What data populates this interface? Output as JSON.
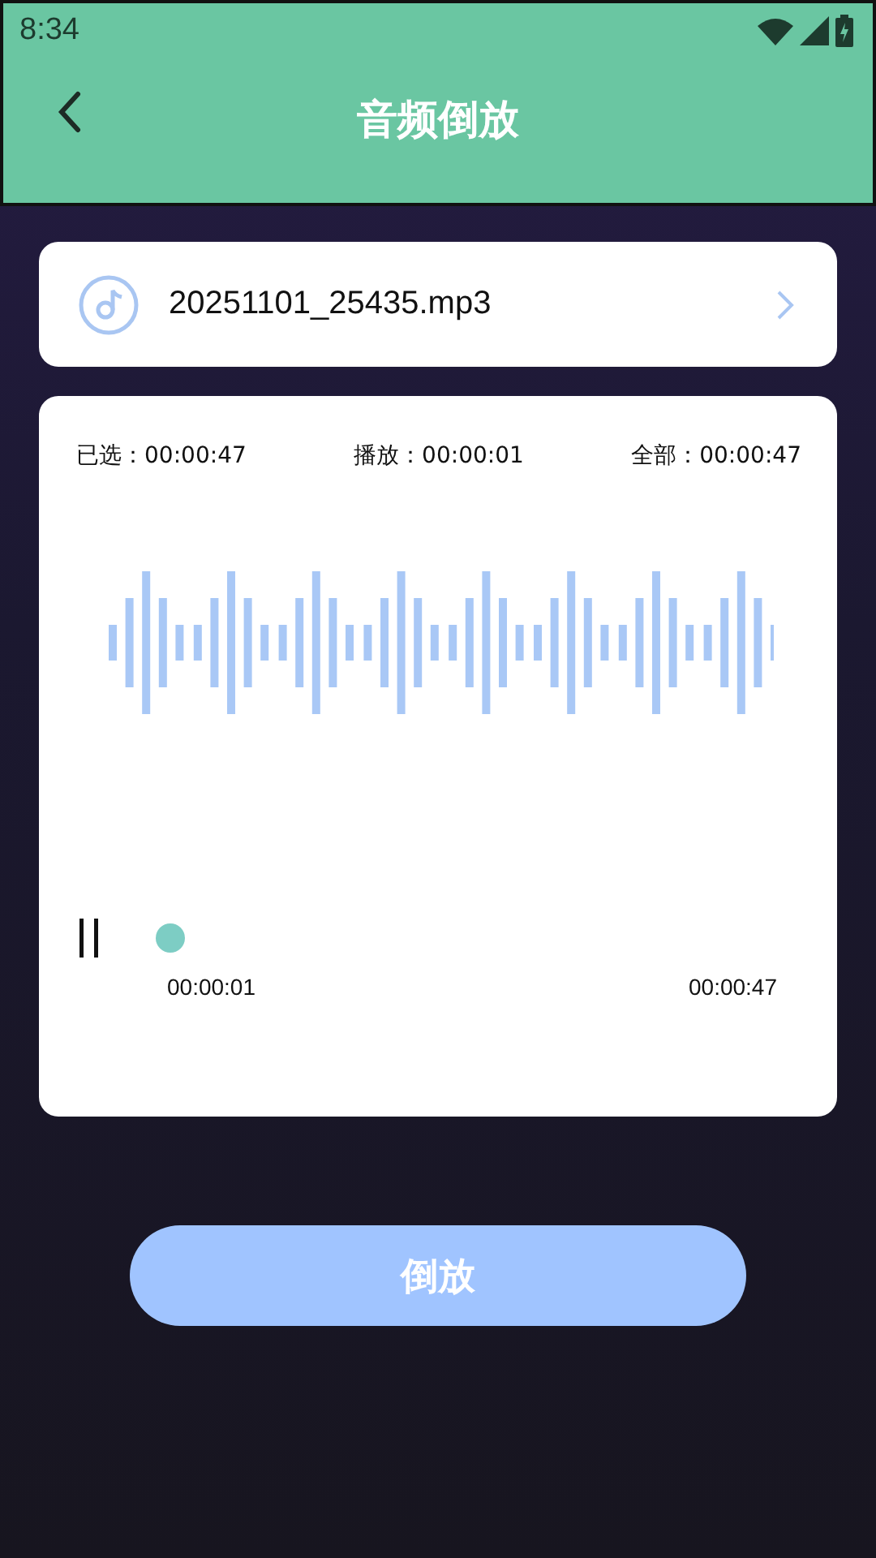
{
  "status_bar": {
    "time": "8:34"
  },
  "header": {
    "title": "音频倒放"
  },
  "file": {
    "name": "20251101_25435.mp3"
  },
  "info": [
    {
      "label": "已选：",
      "value": "00:00:47"
    },
    {
      "label": "播放：",
      "value": "00:00:01"
    },
    {
      "label": "全部：",
      "value": "00:00:47"
    }
  ],
  "player": {
    "playing": true,
    "level": 0.02,
    "current": "00:00:01",
    "total": "00:00:47"
  },
  "action": {
    "label": "倒放"
  }
}
